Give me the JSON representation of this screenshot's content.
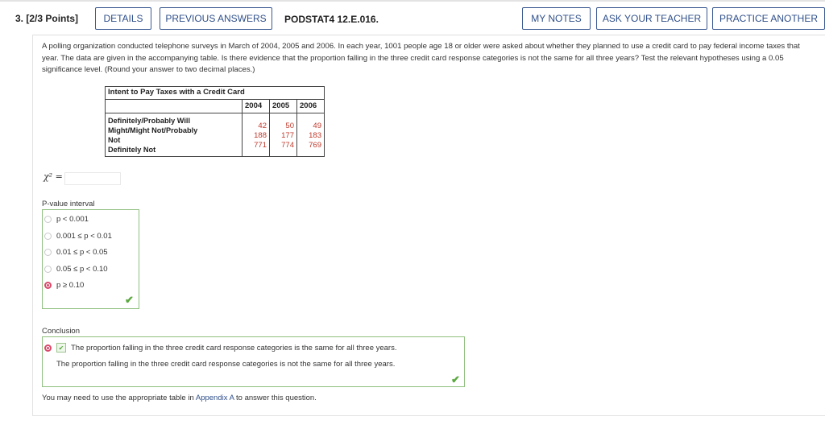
{
  "header": {
    "question_number": "3.",
    "points": "[2/3 Points]",
    "details_label": "DETAILS",
    "previous_answers_label": "PREVIOUS ANSWERS",
    "question_code": "PODSTAT4 12.E.016.",
    "my_notes_label": "MY NOTES",
    "ask_teacher_label": "ASK YOUR TEACHER",
    "practice_another_label": "PRACTICE ANOTHER"
  },
  "question": {
    "text": "A polling organization conducted telephone surveys in March of 2004, 2005 and 2006. In each year, 1001 people age 18 or older were asked about whether they planned to use a credit card to pay federal income taxes that year. The data are given in the accompanying table. Is there evidence that the proportion falling in the three credit card response categories is not the same for all three years? Test the relevant hypotheses using a 0.05 significance level. (Round your answer to two decimal places.)"
  },
  "table": {
    "title": "Intent to Pay Taxes with a Credit Card",
    "years": [
      "2004",
      "2005",
      "2006"
    ],
    "row_labels": [
      "Definitely/Probably Will",
      "Might/Might Not/Probably",
      "Not",
      "Definitely Not"
    ],
    "rows": [
      [
        "42",
        "50",
        "49"
      ],
      [
        "188",
        "177",
        "183"
      ],
      [
        "771",
        "774",
        "769"
      ]
    ]
  },
  "chi_square": {
    "label": "χ² =",
    "value": ""
  },
  "pvalue": {
    "label": "P-value interval",
    "options": [
      "p < 0.001",
      "0.001 ≤ p < 0.01",
      "0.01 ≤ p < 0.05",
      "0.05 ≤ p < 0.10",
      "p ≥ 0.10"
    ],
    "selected_index": 4
  },
  "conclusion": {
    "label": "Conclusion",
    "options": [
      "The proportion falling in the three credit card response categories is the same for all three years.",
      "The proportion falling in the three credit card response categories is not the same for all three years."
    ],
    "selected_index": 0
  },
  "footer": {
    "text_before": "You may need to use the appropriate table in ",
    "link_text": "Appendix A",
    "text_after": " to answer this question."
  },
  "colors": {
    "button_border": "#3b5a92",
    "correct_green": "#5aa83f",
    "selected_radio": "#d94a6a",
    "table_numbers": "#c0392b"
  }
}
